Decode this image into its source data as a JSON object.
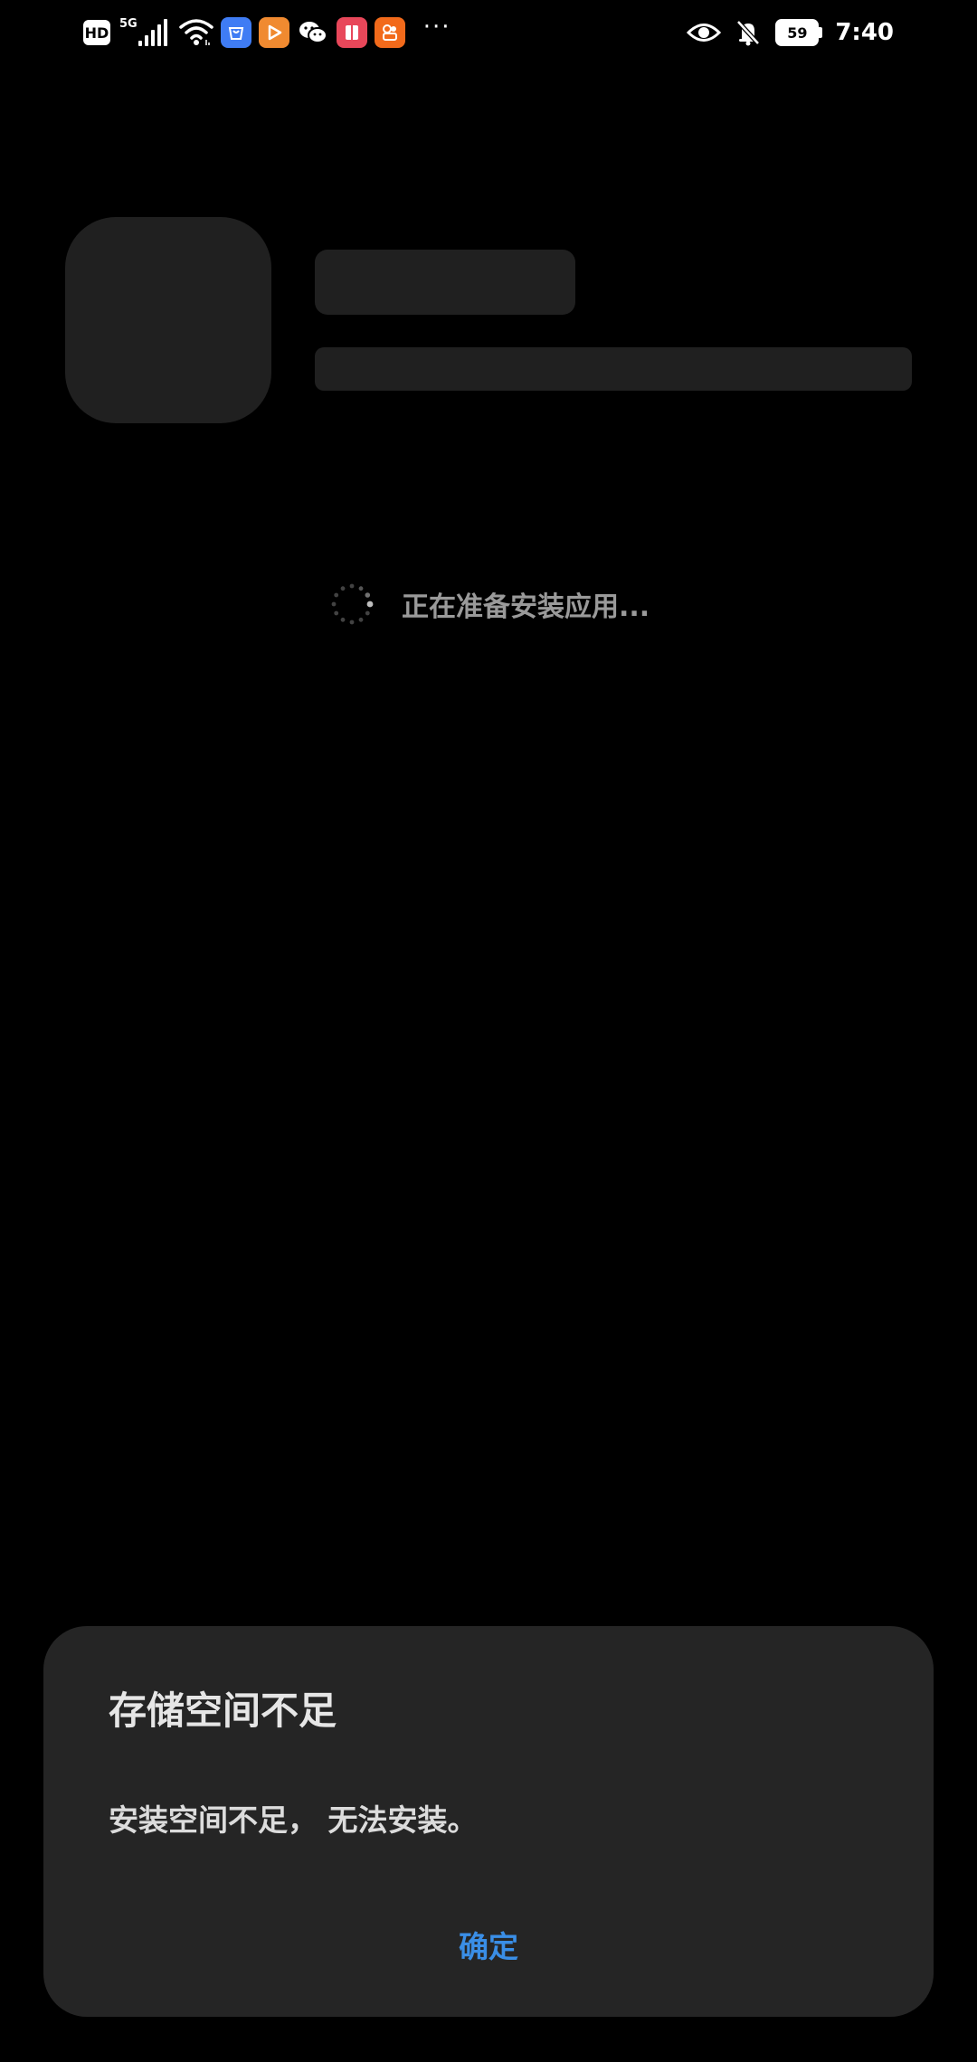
{
  "status_bar": {
    "hd_badge": "HD",
    "network_type": "5G",
    "battery_level": "59",
    "time": "7:40",
    "more_indicator": "···",
    "icons": [
      "signal-icon",
      "wifi-icon",
      "app-store-icon",
      "video-app-icon",
      "wechat-icon",
      "reader-app-icon",
      "game-app-icon",
      "eye-icon",
      "bell-muted-icon",
      "battery-icon"
    ]
  },
  "installer": {
    "loading_text": "正在准备安装应用..."
  },
  "dialog": {
    "title": "存储空间不足",
    "message": "安装空间不足， 无法安装。",
    "confirm_label": "确定"
  },
  "colors": {
    "background": "#000000",
    "placeholder": "#202020",
    "dialog_background": "#252525",
    "accent": "#3a8ee6"
  }
}
